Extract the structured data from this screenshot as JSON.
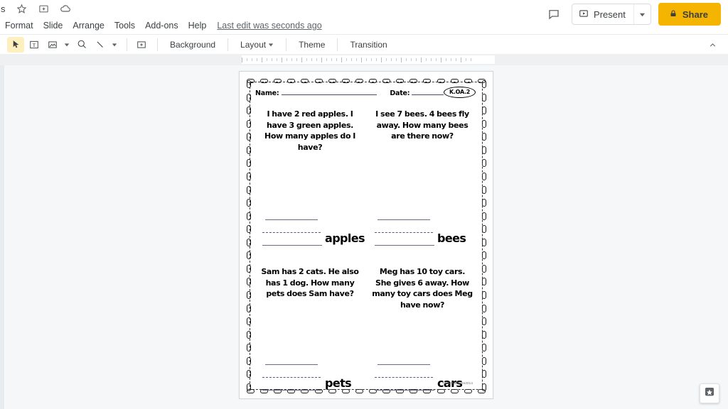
{
  "app": {
    "doc_title_visible": "s",
    "title_icons": [
      "star-icon",
      "move-to-folder-icon",
      "cloud-saved-icon"
    ]
  },
  "menubar": {
    "items": [
      {
        "label": "Format",
        "name": "menu-format"
      },
      {
        "label": "Slide",
        "name": "menu-slide"
      },
      {
        "label": "Arrange",
        "name": "menu-arrange"
      },
      {
        "label": "Tools",
        "name": "menu-tools"
      },
      {
        "label": "Add-ons",
        "name": "menu-addons"
      },
      {
        "label": "Help",
        "name": "menu-help"
      }
    ],
    "last_edit": "Last edit was seconds ago"
  },
  "header_actions": {
    "comment_icon": "comment-icon",
    "present_label": "Present",
    "present_icon": "present-play-icon",
    "present_caret": "chevron-down-icon",
    "share_label": "Share",
    "share_icon": "lock-icon",
    "share_color": "#f4b400"
  },
  "toolbar": {
    "icons": [
      {
        "name": "select-cursor-icon",
        "active": true
      },
      {
        "name": "text-box-icon",
        "active": false
      },
      {
        "name": "insert-image-icon",
        "active": false
      },
      {
        "name": "shape-icon",
        "active": false
      },
      {
        "name": "line-icon",
        "active": false
      },
      {
        "name": "insert-comment-icon",
        "active": false
      }
    ],
    "buttons": [
      {
        "label": "Background",
        "name": "background-button",
        "caret": false
      },
      {
        "label": "Layout",
        "name": "layout-button",
        "caret": true
      },
      {
        "label": "Theme",
        "name": "theme-button",
        "caret": false
      },
      {
        "label": "Transition",
        "name": "transition-button",
        "caret": false
      }
    ],
    "collapse_icon": "chevron-up-icon"
  },
  "worksheet": {
    "name_label": "Name:",
    "date_label": "Date:",
    "standard_badge": "K.OA.2",
    "problems": [
      {
        "text": "I have 2 red apples. I have 3 green apples. How many apples do I have?",
        "answer_label": "apples"
      },
      {
        "text": "I see 7 bees. 4 bees fly away. How many bees are there now?",
        "answer_label": "bees"
      },
      {
        "text": "Sam has 2 cats. He also has 1 dog. How many pets does Sam have?",
        "answer_label": "pets"
      },
      {
        "text": "Meg has 10 toy cars. She gives 6 away. How many toy cars does Meg have now?",
        "answer_label": "cars"
      }
    ],
    "copyright": "©MarthaMoore2014"
  },
  "explore": {
    "icon": "explore-add-icon"
  }
}
